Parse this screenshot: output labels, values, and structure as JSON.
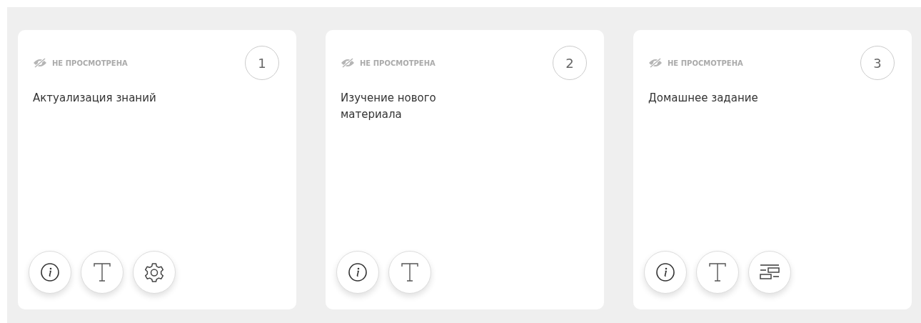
{
  "cards": [
    {
      "status": "НЕ ПРОСМОТРЕНА",
      "viewed": false,
      "number": "1",
      "title": "Актуализация знаний",
      "tools": [
        {
          "kind": "info"
        },
        {
          "kind": "text"
        },
        {
          "kind": "settings"
        }
      ]
    },
    {
      "status": "НЕ ПРОСМОТРЕНА",
      "viewed": false,
      "number": "2",
      "title": "Изучение нового материала",
      "tools": [
        {
          "kind": "info"
        },
        {
          "kind": "text"
        }
      ]
    },
    {
      "status": "НЕ ПРОСМОТРЕНА",
      "viewed": false,
      "number": "3",
      "title": "Домашнее задание",
      "tools": [
        {
          "kind": "info"
        },
        {
          "kind": "text"
        },
        {
          "kind": "layout"
        }
      ]
    }
  ]
}
